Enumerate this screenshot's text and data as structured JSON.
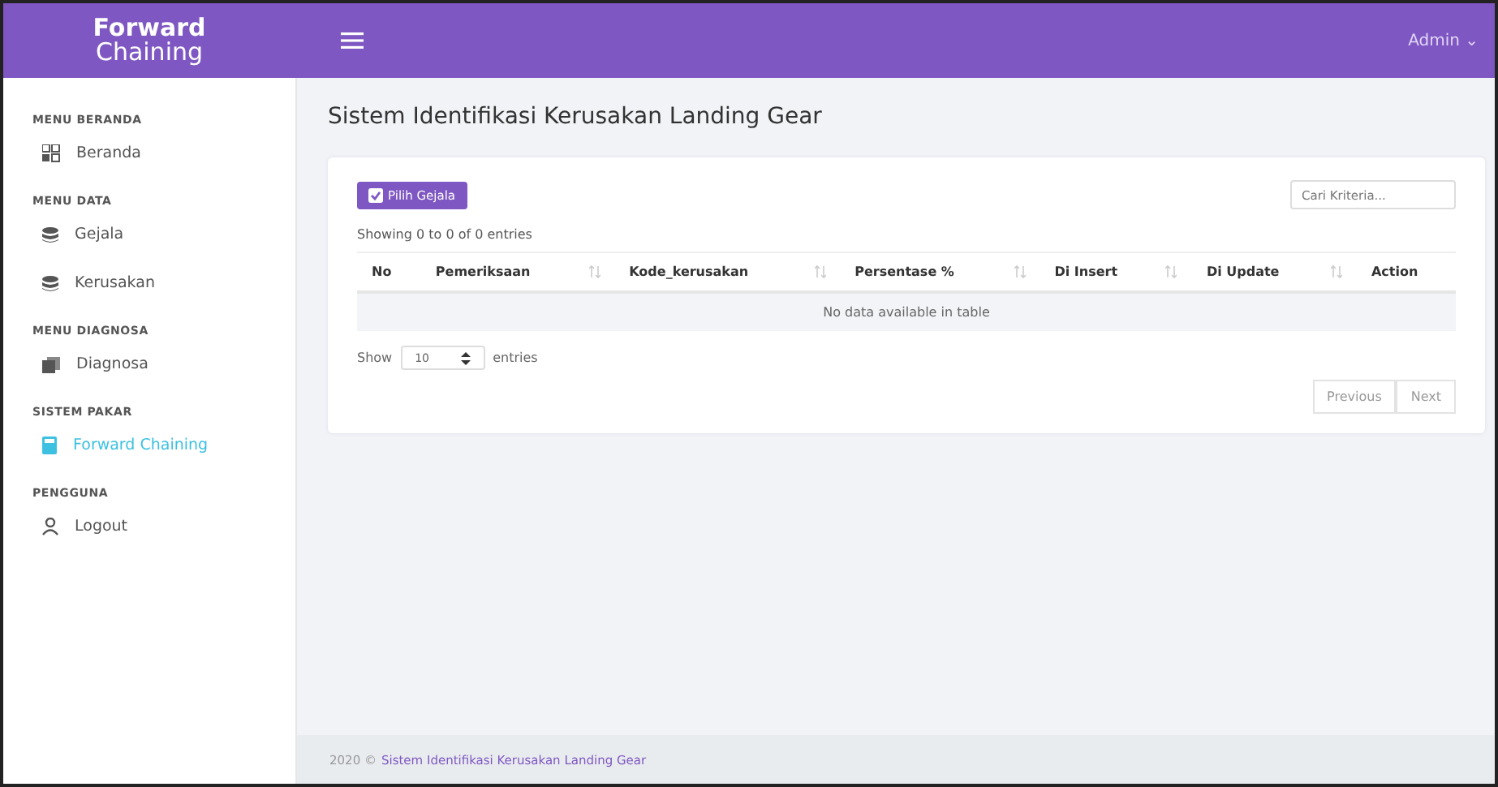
{
  "brand": {
    "line_1": "Forward",
    "line_2": "Chaining"
  },
  "user_menu": {
    "label": "Admin",
    "caret": "⌄"
  },
  "sidebar": {
    "sections": [
      {
        "heading": "MENU BERANDA",
        "items": [
          {
            "label": "Beranda",
            "kind": "grid",
            "selected": false
          }
        ]
      },
      {
        "heading": "MENU DATA",
        "items": [
          {
            "label": "Gejala",
            "kind": "database",
            "selected": false
          },
          {
            "label": "Kerusakan",
            "kind": "database",
            "selected": false
          }
        ]
      },
      {
        "heading": "MENU DIAGNOSA",
        "items": [
          {
            "label": "Diagnosa",
            "kind": "cards",
            "selected": false
          }
        ]
      },
      {
        "heading": "SISTEM PAKAR",
        "items": [
          {
            "label": "Forward Chaining",
            "kind": "calculator",
            "selected": true
          }
        ]
      },
      {
        "heading": "PENGGUNA",
        "items": [
          {
            "label": "Logout",
            "kind": "user",
            "selected": false
          }
        ]
      }
    ]
  },
  "page_title": "Sistem Identifikasi Kerusakan Landing Gear",
  "card": {
    "button": "Pilih Gejala",
    "search": {
      "placeholder": "Cari Kriteria..."
    },
    "info": "Showing 0 to 0 of 0 entries",
    "table": {
      "columns": [
        {
          "label": "No",
          "sortable": false
        },
        {
          "label": "Pemeriksaan",
          "sortable": true
        },
        {
          "label": "Kode_kerusakan",
          "sortable": true
        },
        {
          "label": "Persentase %",
          "sortable": true
        },
        {
          "label": "Di Insert",
          "sortable": true
        },
        {
          "label": "Di Update",
          "sortable": true
        },
        {
          "label": "Action",
          "sortable": false
        }
      ],
      "empty_message": "No data available in table"
    },
    "length": {
      "prefix": "Show",
      "value": "10",
      "suffix": "entries"
    },
    "pagination": [
      "Previous",
      "Next"
    ]
  },
  "footer": {
    "prefix": "2020 ©",
    "link": "Sistem Identifikasi Kerusakan Landing Gear"
  }
}
